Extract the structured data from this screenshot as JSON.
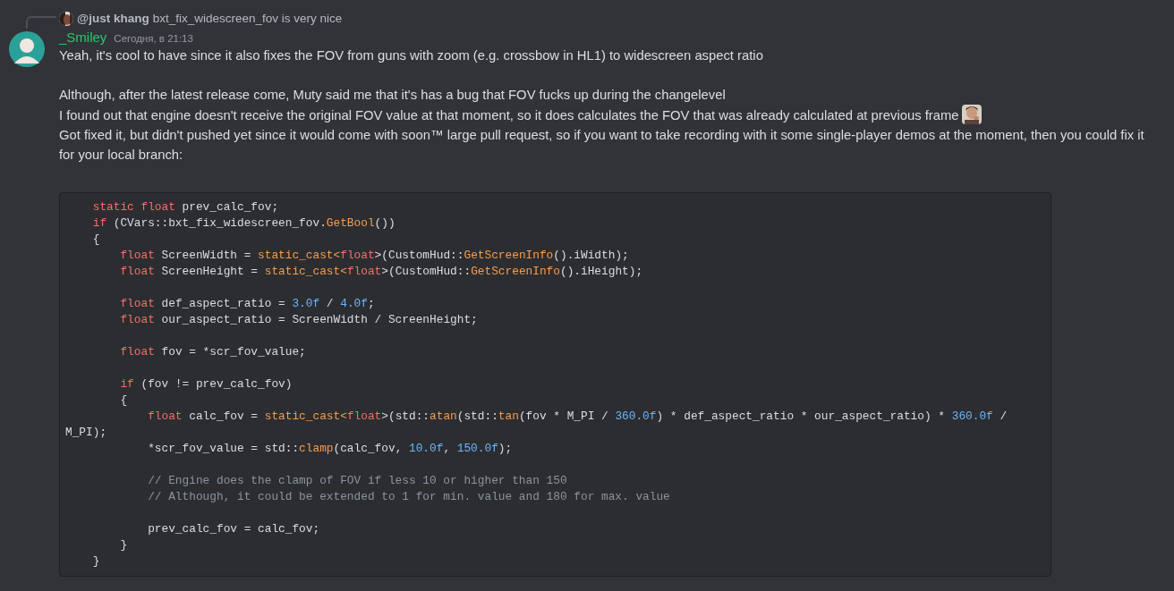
{
  "reply": {
    "author": "@just khang",
    "text": "bxt_fix_widescreen_fov is very nice"
  },
  "message": {
    "author": "_Smiley",
    "timestamp": "Сегодня, в 21:13",
    "blocks": [
      {
        "kind": "text",
        "lines": [
          {
            "text": "Yeah, it's cool to have since it also fixes the FOV from guns with zoom (e.g. crossbow in HL1) to widescreen aspect ratio",
            "emoji": false
          }
        ]
      },
      {
        "kind": "text",
        "lines": [
          {
            "text": "Although, after the latest release come, Muty said me that it's has a bug that FOV fucks up during the changelevel",
            "emoji": false
          },
          {
            "text": "I found out that engine doesn't receive the original FOV value at that moment, so it does calculates the FOV that was already calculated at previous frame",
            "emoji": true
          },
          {
            "text": "Got fixed it, but didn't pushed yet since it would come with soon™ large pull request, so if you want to take recording with it some single-player demos at the moment, then you could fix it for your local branch:",
            "emoji": false
          }
        ]
      },
      {
        "kind": "code",
        "lines": [
          {
            "kind": "code",
            "tokens": [
              {
                "kind": "keyword",
                "text": "    static float"
              },
              {
                "kind": "plain",
                "text": " prev_calc_fov;"
              }
            ]
          },
          {
            "kind": "code",
            "tokens": [
              {
                "kind": "keyword",
                "text": "    if"
              },
              {
                "kind": "plain",
                "text": " (CVars::bxt_fix_widescreen_fov."
              },
              {
                "kind": "function",
                "text": "GetBool"
              },
              {
                "kind": "plain",
                "text": "())"
              }
            ]
          },
          {
            "kind": "code",
            "tokens": [
              {
                "kind": "plain",
                "text": "    {"
              }
            ]
          },
          {
            "kind": "code",
            "tokens": [
              {
                "kind": "keyword",
                "text": "        float"
              },
              {
                "kind": "plain",
                "text": " ScreenWidth = "
              },
              {
                "kind": "function",
                "text": "static_cast<"
              },
              {
                "kind": "keyword",
                "text": "float"
              },
              {
                "kind": "plain",
                "text": ">(CustomHud::"
              },
              {
                "kind": "function",
                "text": "GetScreenInfo"
              },
              {
                "kind": "plain",
                "text": "().iWidth);"
              }
            ]
          },
          {
            "kind": "code",
            "tokens": [
              {
                "kind": "keyword",
                "text": "        float"
              },
              {
                "kind": "plain",
                "text": " ScreenHeight = "
              },
              {
                "kind": "function",
                "text": "static_cast<"
              },
              {
                "kind": "keyword",
                "text": "float"
              },
              {
                "kind": "plain",
                "text": ">(CustomHud::"
              },
              {
                "kind": "function",
                "text": "GetScreenInfo"
              },
              {
                "kind": "plain",
                "text": "().iHeight);"
              }
            ]
          },
          {
            "kind": "blank"
          },
          {
            "kind": "code",
            "tokens": [
              {
                "kind": "keyword",
                "text": "        float"
              },
              {
                "kind": "plain",
                "text": " def_aspect_ratio = "
              },
              {
                "kind": "number",
                "text": "3.0f"
              },
              {
                "kind": "plain",
                "text": " / "
              },
              {
                "kind": "number",
                "text": "4.0f"
              },
              {
                "kind": "plain",
                "text": ";"
              }
            ]
          },
          {
            "kind": "code",
            "tokens": [
              {
                "kind": "keyword",
                "text": "        float"
              },
              {
                "kind": "plain",
                "text": " our_aspect_ratio = ScreenWidth / ScreenHeight;"
              }
            ]
          },
          {
            "kind": "blank"
          },
          {
            "kind": "code",
            "tokens": [
              {
                "kind": "keyword",
                "text": "        float"
              },
              {
                "kind": "plain",
                "text": " fov = *scr_fov_value;"
              }
            ]
          },
          {
            "kind": "blank"
          },
          {
            "kind": "code",
            "tokens": [
              {
                "kind": "keyword",
                "text": "        if"
              },
              {
                "kind": "plain",
                "text": " (fov != prev_calc_fov)"
              }
            ]
          },
          {
            "kind": "code",
            "tokens": [
              {
                "kind": "plain",
                "text": "        {"
              }
            ]
          },
          {
            "kind": "code",
            "tokens": [
              {
                "kind": "keyword",
                "text": "            float"
              },
              {
                "kind": "plain",
                "text": " calc_fov = "
              },
              {
                "kind": "function",
                "text": "static_cast<"
              },
              {
                "kind": "keyword",
                "text": "float"
              },
              {
                "kind": "plain",
                "text": ">(std::"
              },
              {
                "kind": "function",
                "text": "atan"
              },
              {
                "kind": "plain",
                "text": "(std::"
              },
              {
                "kind": "function",
                "text": "tan"
              },
              {
                "kind": "plain",
                "text": "(fov * M_PI / "
              },
              {
                "kind": "number",
                "text": "360.0f"
              },
              {
                "kind": "plain",
                "text": ") * def_aspect_ratio * our_aspect_ratio) * "
              },
              {
                "kind": "number",
                "text": "360.0f"
              },
              {
                "kind": "plain",
                "text": " / M_PI);"
              }
            ]
          },
          {
            "kind": "code",
            "tokens": [
              {
                "kind": "plain",
                "text": "            *scr_fov_value = std::"
              },
              {
                "kind": "function",
                "text": "clamp"
              },
              {
                "kind": "plain",
                "text": "(calc_fov, "
              },
              {
                "kind": "number",
                "text": "10.0f"
              },
              {
                "kind": "plain",
                "text": ", "
              },
              {
                "kind": "number",
                "text": "150.0f"
              },
              {
                "kind": "plain",
                "text": ");"
              }
            ]
          },
          {
            "kind": "blank"
          },
          {
            "kind": "code",
            "tokens": [
              {
                "kind": "comment",
                "text": "            // Engine does the clamp of FOV if less 10 or higher than 150"
              }
            ]
          },
          {
            "kind": "code",
            "tokens": [
              {
                "kind": "comment",
                "text": "            // Although, it could be extended to 1 for min. value and 180 for max. value"
              }
            ]
          },
          {
            "kind": "blank"
          },
          {
            "kind": "code",
            "tokens": [
              {
                "kind": "plain",
                "text": "            prev_calc_fov = calc_fov;"
              }
            ]
          },
          {
            "kind": "code",
            "tokens": [
              {
                "kind": "plain",
                "text": "        }"
              }
            ]
          },
          {
            "kind": "code",
            "tokens": [
              {
                "kind": "plain",
                "text": "    }"
              }
            ]
          }
        ]
      }
    ]
  }
}
